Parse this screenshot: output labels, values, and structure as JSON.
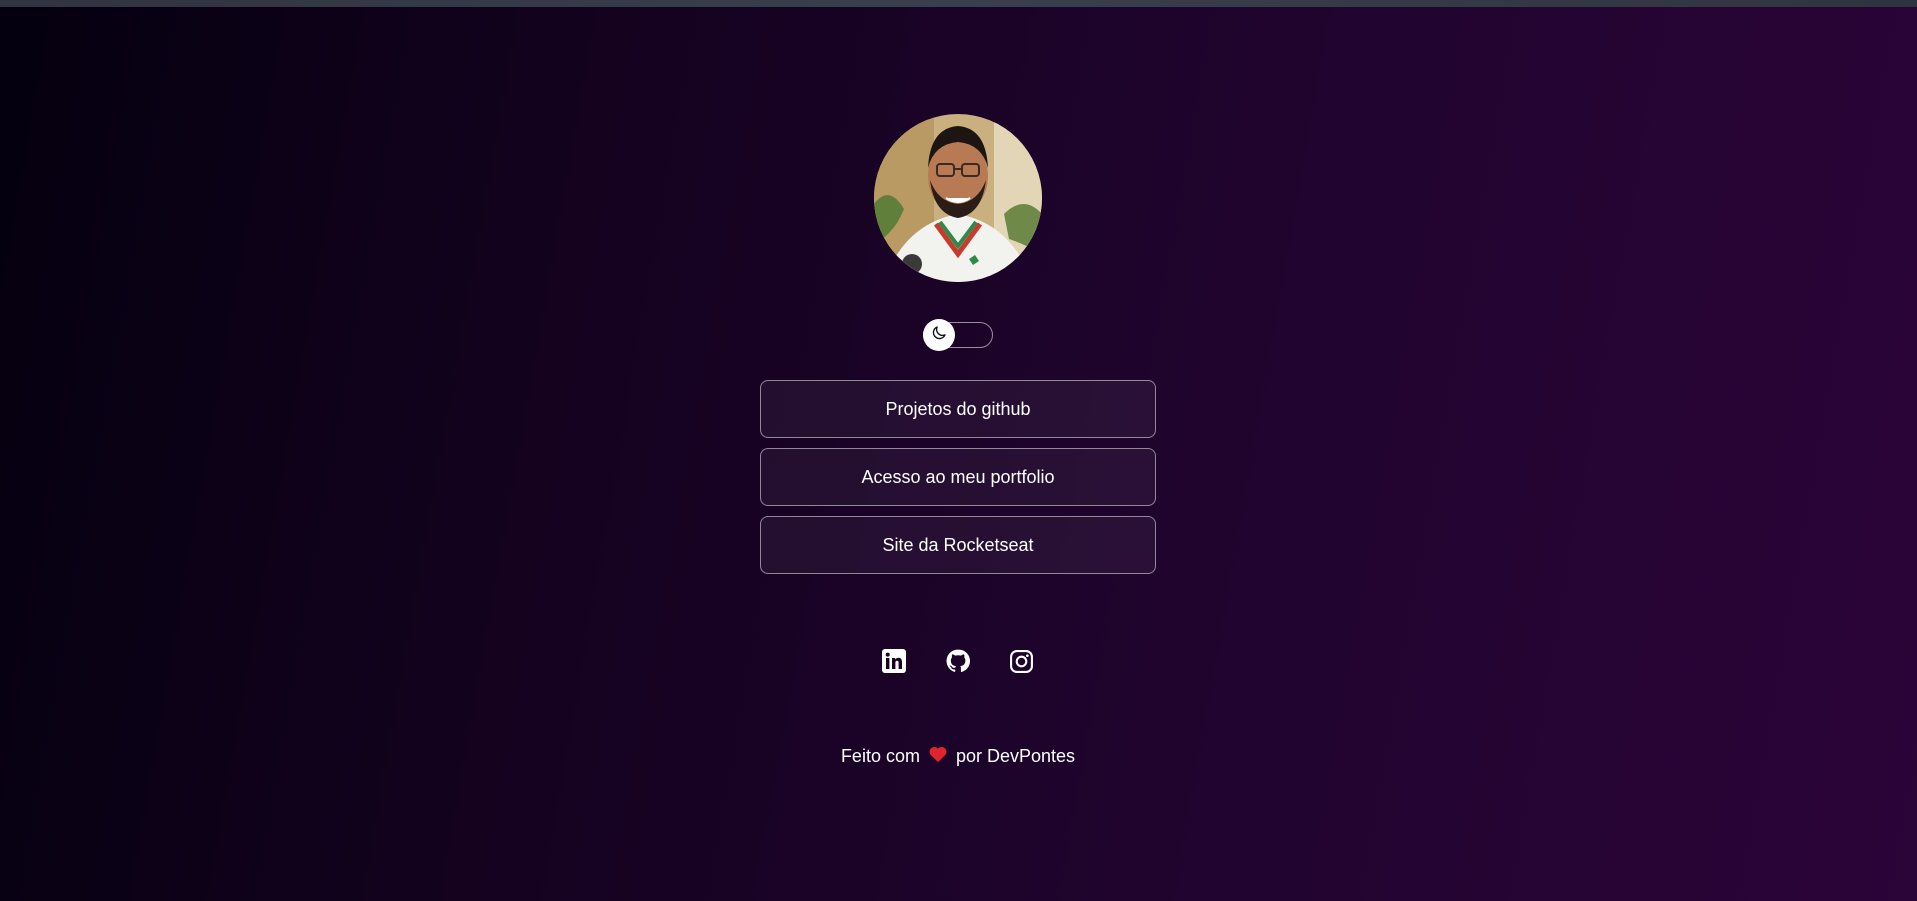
{
  "page": {
    "background_start": "#04000f",
    "background_end": "#2b0438"
  },
  "profile": {
    "photo": "profile-photo-avatar",
    "alt": "profile photo"
  },
  "theme_switch": {
    "icon": "moon-icon",
    "state": "dark"
  },
  "links": [
    {
      "label": "Projetos do github"
    },
    {
      "label": "Acesso ao meu portfolio"
    },
    {
      "label": "Site da Rocketseat"
    }
  ],
  "socials": [
    {
      "icon": "linkedin-icon"
    },
    {
      "icon": "github-icon"
    },
    {
      "icon": "instagram-icon"
    }
  ],
  "footer": {
    "prefix": "Feito com",
    "heart": "heart-icon",
    "heart_color": "#e0242f",
    "suffix": "por DevPontes"
  },
  "colors": {
    "accent_border": "#ffffff",
    "text": "#ffffff"
  }
}
